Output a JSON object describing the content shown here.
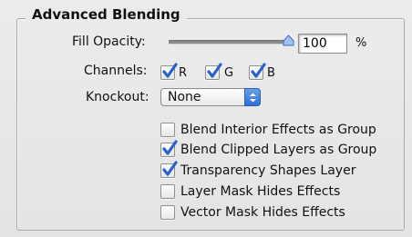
{
  "title": "Advanced Blending",
  "fill_opacity": {
    "label": "Fill Opacity:",
    "value": "100",
    "unit": "%",
    "slider_level": 1.0
  },
  "channels": {
    "label": "Channels:",
    "items": [
      {
        "label": "R",
        "checked": true
      },
      {
        "label": "G",
        "checked": true
      },
      {
        "label": "B",
        "checked": true
      }
    ]
  },
  "knockout": {
    "label": "Knockout:",
    "value": "None"
  },
  "options": [
    {
      "label": "Blend Interior Effects as Group",
      "checked": false
    },
    {
      "label": "Blend Clipped Layers as Group",
      "checked": true
    },
    {
      "label": "Transparency Shapes Layer",
      "checked": true
    },
    {
      "label": "Layer Mask Hides Effects",
      "checked": false
    },
    {
      "label": "Vector Mask Hides Effects",
      "checked": false
    }
  ],
  "colors": {
    "check": "#2a63c8",
    "select_accent": "#2f6fd6"
  }
}
